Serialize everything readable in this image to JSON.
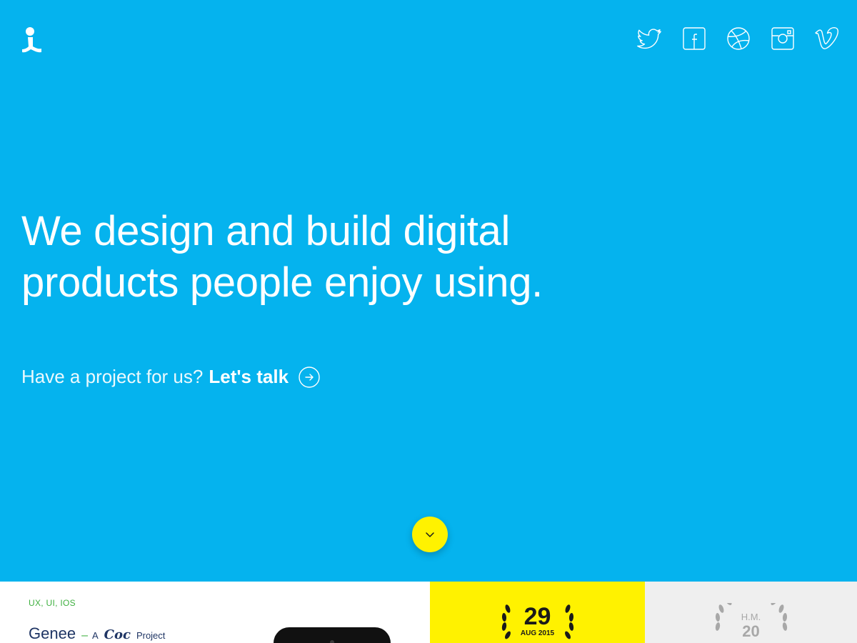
{
  "hero": {
    "background_color": "#05b3ee",
    "logo_icon": "person-logo-icon",
    "headline_line1": "We design and build digital",
    "headline_line2": "products people enjoy using.",
    "cta_text": "Have a project for us?",
    "cta_link": "Let's talk",
    "cta_icon": "arrow-right-circle-icon",
    "scroll_icon": "chevron-down-icon",
    "scroll_button_color": "#fff200"
  },
  "social": [
    {
      "name": "twitter",
      "icon": "twitter-icon"
    },
    {
      "name": "facebook",
      "icon": "facebook-icon"
    },
    {
      "name": "dribbble",
      "icon": "dribbble-icon"
    },
    {
      "name": "instagram",
      "icon": "instagram-icon"
    },
    {
      "name": "vimeo",
      "icon": "vimeo-icon"
    }
  ],
  "project_card": {
    "tags": "UX, UI, IOS",
    "title": "Genee",
    "separator": "–",
    "article": "A",
    "brand": "Coc",
    "suffix": "Project",
    "tag_color": "#3fb040",
    "title_color": "#1f3564"
  },
  "award_yellow": {
    "day": "29",
    "date": "AUG 2015",
    "background": "#fff200"
  },
  "award_grey": {
    "abbr": "H.M.",
    "day": "20",
    "background": "#efefef"
  }
}
